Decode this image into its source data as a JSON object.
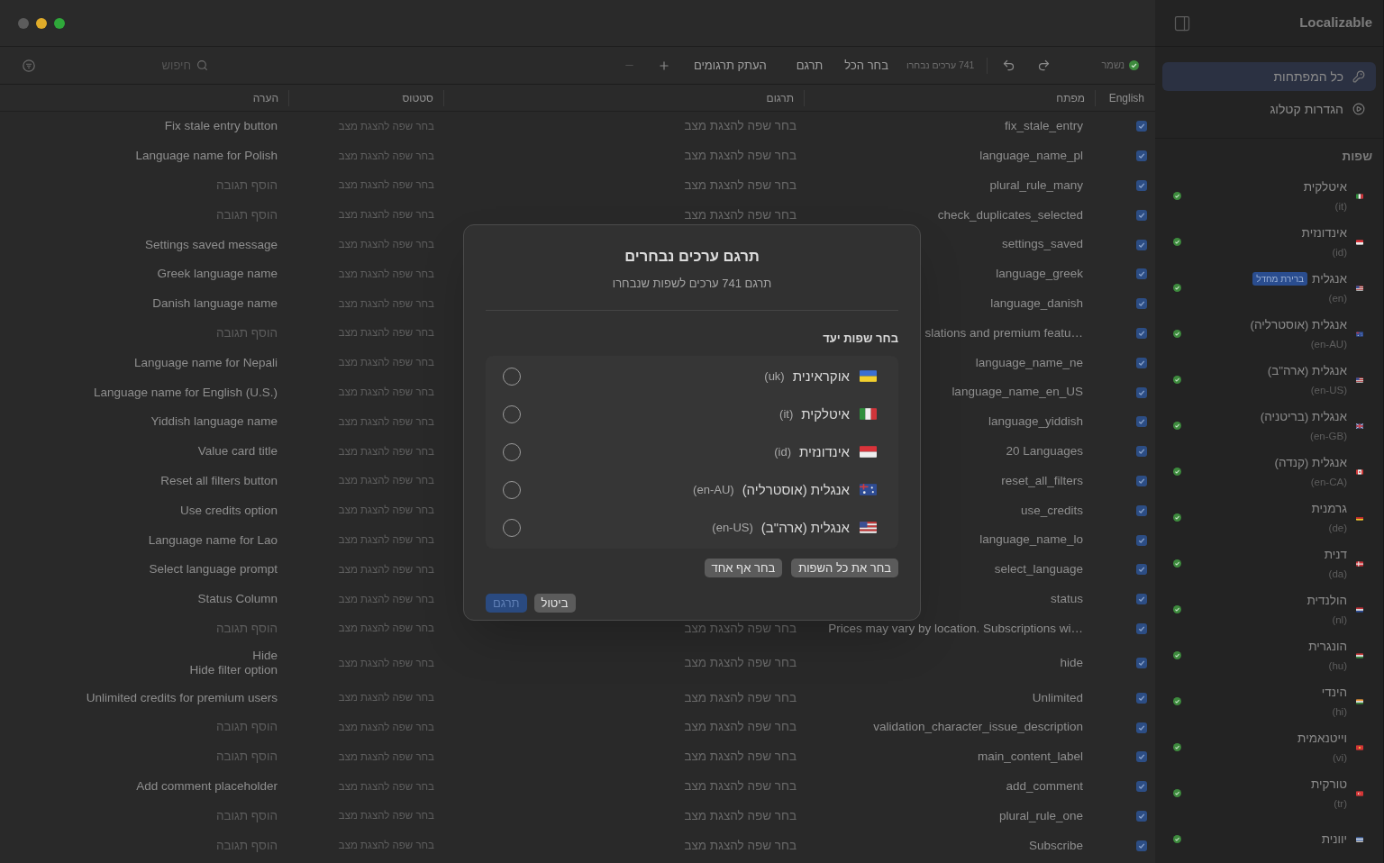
{
  "window": {
    "title": "Localizable"
  },
  "toolbar": {
    "save_status": "נשמר",
    "selection_count": "741 ערכים נבחרו",
    "select_all": "בחר הכל",
    "translate": "תרגם",
    "copy_translations": "העתק תרגומים",
    "remove_disabled": true,
    "search": {
      "placeholder": "חיפוש"
    }
  },
  "sidebar": {
    "items": [
      {
        "label": "כל המפתחות",
        "selected": true,
        "kind": "keys"
      },
      {
        "label": "הגדרות קטלוג",
        "selected": false,
        "kind": "settings"
      }
    ],
    "languages_heading": "שפות",
    "languages": [
      {
        "name": "איטלקית",
        "code": "(it)",
        "kind": "it",
        "complete": true
      },
      {
        "name": "אינדונזית",
        "code": "(id)",
        "kind": "id",
        "complete": true
      },
      {
        "name": "אנגלית",
        "code": "(en)",
        "kind": "us",
        "badge": "ברירת מחדל",
        "complete": true
      },
      {
        "name": "אנגלית (אוסטרליה)",
        "code": "(en-AU)",
        "kind": "au",
        "complete": true
      },
      {
        "name": "אנגלית (ארה\"ב)",
        "code": "(en-US)",
        "kind": "us",
        "complete": true
      },
      {
        "name": "אנגלית (בריטניה)",
        "code": "(en-GB)",
        "kind": "gb",
        "complete": true
      },
      {
        "name": "אנגלית (קנדה)",
        "code": "(en-CA)",
        "kind": "ca",
        "complete": true
      },
      {
        "name": "גרמנית",
        "code": "(de)",
        "kind": "de",
        "complete": true
      },
      {
        "name": "דנית",
        "code": "(da)",
        "kind": "dk",
        "complete": true
      },
      {
        "name": "הולנדית",
        "code": "(nl)",
        "kind": "nl",
        "complete": true
      },
      {
        "name": "הונגרית",
        "code": "(hu)",
        "kind": "hu",
        "complete": true
      },
      {
        "name": "הינדי",
        "code": "(hi)",
        "kind": "in",
        "complete": true
      },
      {
        "name": "וייטנאמית",
        "code": "(vi)",
        "kind": "vn",
        "complete": true
      },
      {
        "name": "טורקית",
        "code": "(tr)",
        "kind": "tr",
        "complete": true
      },
      {
        "name": "יוונית",
        "kind": "gr",
        "complete": true
      }
    ]
  },
  "table": {
    "columns": [
      "English",
      "מפתח",
      "תרגום",
      "סטטוס",
      "הערה"
    ],
    "rows": [
      {
        "checked": true,
        "key": "fix_stale_entry",
        "translation": "בחר שפה להצגת מצב",
        "status": "בחר שפה להצגת מצב",
        "comment": "Fix stale entry button"
      },
      {
        "checked": true,
        "key": "language_name_pl",
        "translation": "בחר שפה להצגת מצב",
        "status": "בחר שפה להצגת מצב",
        "comment": "Language name for Polish"
      },
      {
        "checked": true,
        "key": "plural_rule_many",
        "translation": "בחר שפה להצגת מצב",
        "status": "בחר שפה להצגת מצב",
        "comment_field": {
          "placeholder": "הוסף תגובה"
        }
      },
      {
        "checked": true,
        "key": "check_duplicates_selected",
        "translation": "בחר שפה להצגת מצב",
        "status": "בחר שפה להצגת מצב",
        "comment_field": {
          "placeholder": "הוסף תגובה"
        }
      },
      {
        "checked": true,
        "key": "settings_saved",
        "status": "בחר שפה להצגת מצב",
        "comment": "Settings saved message"
      },
      {
        "checked": true,
        "key": "language_greek",
        "status": "בחר שפה להצגת מצב",
        "comment": "Greek language name"
      },
      {
        "checked": true,
        "key": "language_danish",
        "status": "בחר שפה להצגת מצב",
        "comment": "Danish language name"
      },
      {
        "checked": true,
        "key": "slations and premium featu…",
        "status": "בחר שפה להצגת מצב",
        "comment_field": {
          "placeholder": "הוסף תגובה"
        }
      },
      {
        "checked": true,
        "key": "language_name_ne",
        "status": "בחר שפה להצגת מצב",
        "comment": "Language name for Nepali"
      },
      {
        "checked": true,
        "key": "language_name_en_US",
        "status": "בחר שפה להצגת מצב",
        "comment": "Language name for English (U.S.)"
      },
      {
        "checked": true,
        "key": "language_yiddish",
        "status": "בחר שפה להצגת מצב",
        "comment": "Yiddish language name"
      },
      {
        "checked": true,
        "key": "20 Languages",
        "status": "בחר שפה להצגת מצב",
        "comment": "Value card title"
      },
      {
        "checked": true,
        "key": "reset_all_filters",
        "status": "בחר שפה להצגת מצב",
        "comment": "Reset all filters button"
      },
      {
        "checked": true,
        "key": "use_credits",
        "status": "בחר שפה להצגת מצב",
        "comment": "Use credits option"
      },
      {
        "checked": true,
        "key": "language_name_lo",
        "status": "בחר שפה להצגת מצב",
        "comment": "Language name for Lao"
      },
      {
        "checked": true,
        "key": "select_language",
        "status": "בחר שפה להצגת מצב",
        "comment": "Select language prompt"
      },
      {
        "checked": true,
        "key": "status",
        "status": "בחר שפה להצגת מצב",
        "comment": "Status Column"
      },
      {
        "checked": true,
        "key": "Prices may vary by location. Subscriptions wi…",
        "translation": "בחר שפה להצגת מצב",
        "status": "בחר שפה להצגת מצב",
        "comment_field": {
          "placeholder": "הוסף תגובה"
        }
      },
      {
        "checked": true,
        "key": "hide",
        "translation": "בחר שפה להצגת מצב",
        "status": "בחר שפה להצגת מצב",
        "comment": "Hide\nHide filter option"
      },
      {
        "checked": true,
        "key": "Unlimited",
        "translation": "בחר שפה להצגת מצב",
        "status": "בחר שפה להצגת מצב",
        "comment": "Unlimited credits for premium users"
      },
      {
        "checked": true,
        "key": "validation_character_issue_description",
        "translation": "בחר שפה להצגת מצב",
        "status": "בחר שפה להצגת מצב",
        "comment_field": {
          "placeholder": "הוסף תגובה"
        }
      },
      {
        "checked": true,
        "key": "main_content_label",
        "translation": "בחר שפה להצגת מצב",
        "status": "בחר שפה להצגת מצב",
        "comment_field": {
          "placeholder": "הוסף תגובה"
        }
      },
      {
        "checked": true,
        "key": "add_comment",
        "translation": "בחר שפה להצגת מצב",
        "status": "בחר שפה להצגת מצב",
        "comment": "Add comment placeholder"
      },
      {
        "checked": true,
        "key": "plural_rule_one",
        "translation": "בחר שפה להצגת מצב",
        "status": "בחר שפה להצגת מצב",
        "comment_field": {
          "placeholder": "הוסף תגובה"
        }
      },
      {
        "checked": true,
        "key": "Subscribe",
        "translation": "בחר שפה להצגת מצב",
        "status": "בחר שפה להצגת מצב",
        "comment_field": {
          "placeholder": "הוסף תגובה"
        }
      }
    ]
  },
  "dialog": {
    "title": "תרגם ערכים נבחרים",
    "subtitle": "תרגם 741 ערכים לשפות שנבחרו",
    "section": "בחר שפות יעד",
    "languages": [
      {
        "name": "אוקראינית",
        "code": "(uk)",
        "kind": "ua",
        "selected": false
      },
      {
        "name": "איטלקית",
        "code": "(it)",
        "kind": "it",
        "selected": false
      },
      {
        "name": "אינדונזית",
        "code": "(id)",
        "kind": "id",
        "selected": false
      },
      {
        "name": "אנגלית (אוסטרליה)",
        "code": "(en-AU)",
        "kind": "au",
        "selected": false
      },
      {
        "name": "אנגלית (ארה\"ב)",
        "code": "(en-US)",
        "kind": "us",
        "selected": false
      }
    ],
    "select_all_button": "בחר את כל השפות",
    "select_none_button": "בחר אף אחד",
    "cancel_button": "ביטול",
    "translate_button": {
      "label": "תרגם",
      "disabled": true
    }
  }
}
